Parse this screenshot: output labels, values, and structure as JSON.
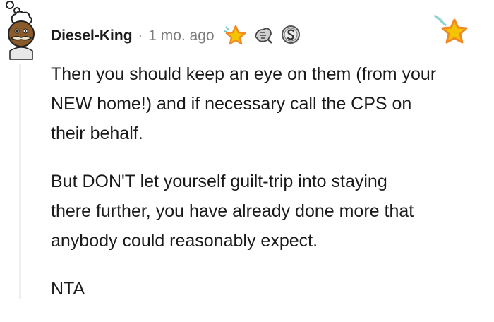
{
  "comment": {
    "author": "Diesel-King",
    "separator": "·",
    "timestamp": "1 mo. ago",
    "awards": [
      "star-award-icon",
      "handshake-award-icon",
      "silver-s-award-icon"
    ],
    "corner_award": "star-award-icon",
    "paragraphs": [
      [
        "Then you should keep an eye on them (from your",
        "NEW home!) and if necessary call the CPS on",
        "their behalf."
      ],
      [
        "But DON'T let yourself guilt-trip into staying",
        "there further, you have already done more that",
        "anybody could reasonably expect."
      ],
      [
        "NTA"
      ]
    ]
  },
  "colors": {
    "meta_gray": "#7c7c7c",
    "award_gold": "#f5c400",
    "award_orange": "#f08a24",
    "thread_line": "#edeff1"
  }
}
